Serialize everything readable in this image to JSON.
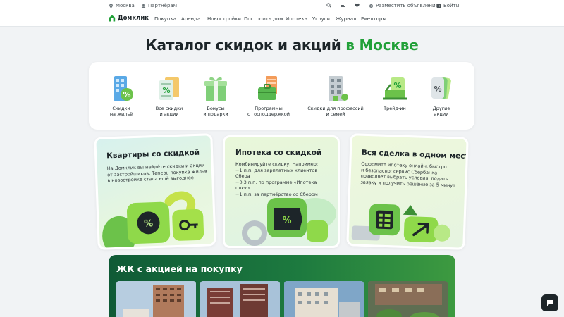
{
  "topbar": {
    "city": "Москва",
    "partners": "Партнёрам",
    "post_ad": "Разместить объявление",
    "login": "Войти"
  },
  "navbar": {
    "logo": "Домклик",
    "items": [
      "Покупка",
      "Аренда",
      "Новостройки",
      "Построить дом",
      "Ипотека",
      "Услуги",
      "Журнал",
      "Риелторы"
    ]
  },
  "page": {
    "title_main": "Каталог скидок и акций",
    "title_accent": "в Москве"
  },
  "categories": [
    {
      "label": "Скидки\nна жильё",
      "icon": "percent-building-icon"
    },
    {
      "label": "Все скидки\nи акции",
      "icon": "percent-document-icon"
    },
    {
      "label": "Бонусы\nи подарки",
      "icon": "gift-icon"
    },
    {
      "label": "Программы\nс господдержкой",
      "icon": "briefcase-icon"
    },
    {
      "label": "Скидки для профессий\nи семей",
      "icon": "building-icon"
    },
    {
      "label": "Трейд-ин",
      "icon": "trade-in-icon"
    },
    {
      "label": "Другие\nакции",
      "icon": "percent-cards-icon"
    }
  ],
  "promos": [
    {
      "title": "Квартиры со скидкой",
      "text": "На Домклик вы найдёте скидки и акции\nот застройщиков. Теперь покупка жилья\nв новостройке стала ещё выгоднее"
    },
    {
      "title": "Ипотека со скидкой",
      "text": "Комбинируйте скидку. Например:\n−1 п.п. для зарплатных клиентов\nСбера\n−0,3 п.п. по программе «Ипотека\nплюс»\n−1 п.п. за партнёрство со Сбером"
    },
    {
      "title": "Вся сделка в одном месте",
      "text": "Оформите ипотеку онлайн, быстро\nи безопасно: сервис Сбербанка\nпозволяет выбрать условия, подать\nзаявку и получить решение за 5 минут"
    }
  ],
  "banner": {
    "title": "ЖК с акцией на покупку"
  },
  "colors": {
    "brand_green": "#21a038",
    "banner_dark": "#0f5a36",
    "text": "#1d2529"
  }
}
